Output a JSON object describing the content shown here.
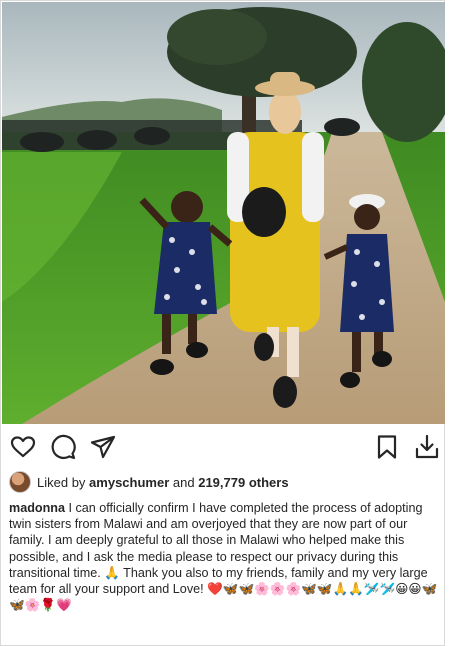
{
  "post": {
    "actions": {
      "like_icon": "heart-outline-icon",
      "comment_icon": "speech-bubble-icon",
      "share_icon": "paper-plane-icon",
      "save_icon": "bookmark-icon",
      "download_icon": "download-icon"
    },
    "likes": {
      "prefix": "Liked by",
      "user": "amyschumer",
      "middle": "and",
      "count": "219,779 others"
    },
    "caption": {
      "username": "madonna",
      "text": "I can officially confirm I have completed the process of adopting twin sisters from Malawi and am overjoyed that they are now part of our family. I am deeply grateful to all those in Malawi who helped make this possible, and I ask the media please to respect our privacy during this transitional time. 🙏 Thank you also to my friends, family and my very large team for all your support and Love! ❤️🦋🦋🌸🌸🌸🦋🦋🙏🙏🛩️🛩️😀😀🦋🦋🌸🌹💗"
    }
  },
  "colors": {
    "text": "#262626",
    "border": "#d9d9d9",
    "grass": "#4c9a2a",
    "sky": "#c9d3d6",
    "dress": "#e6c21f"
  }
}
